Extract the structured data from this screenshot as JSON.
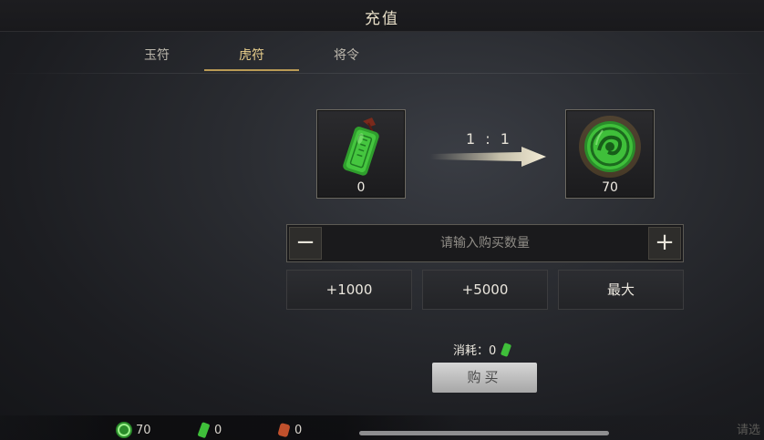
{
  "header": {
    "title": "充值"
  },
  "tabs": [
    {
      "label": "玉符",
      "active": false
    },
    {
      "label": "虎符",
      "active": true
    },
    {
      "label": "将令",
      "active": false
    }
  ],
  "exchange": {
    "from": {
      "icon": "jade-tally-icon",
      "count": "0"
    },
    "ratio": "1 : 1",
    "to": {
      "icon": "jade-disc-coin-icon",
      "count": "70"
    }
  },
  "quantity": {
    "placeholder": "请输入购买数量",
    "minus": "−",
    "plus": "+"
  },
  "quick_buttons": [
    "+1000",
    "+5000",
    "最大"
  ],
  "cost": {
    "label": "消耗：",
    "value": "0"
  },
  "buy_button": "购买",
  "currencies": [
    {
      "icon": "jade-coin-icon",
      "value": "70"
    },
    {
      "icon": "green-tally-icon",
      "value": "0"
    },
    {
      "icon": "red-tally-icon",
      "value": "0"
    }
  ],
  "footer_hint": "请选",
  "colors": {
    "accent_gold": "#e9cf8c",
    "jade_green": "#3fbf3a",
    "buy_button": "#c2c2c2"
  }
}
